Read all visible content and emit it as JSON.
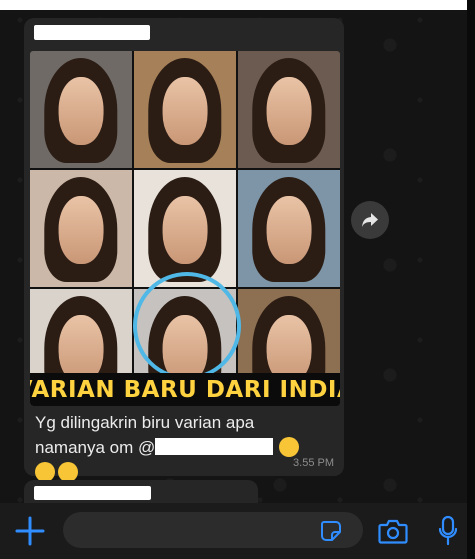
{
  "message": {
    "caption_image_text": "VARIAN BARU DARI INDIA",
    "text_line1": "Yg dilingakrin biru varian apa",
    "text_line2_prefix": "namanya om @",
    "timestamp": "3.55 PM"
  },
  "icons": {
    "forward": "forward-arrow-icon",
    "attach": "plus-icon",
    "sticker": "sticker-icon",
    "camera": "camera-icon",
    "mic": "microphone-icon"
  },
  "colors": {
    "accent": "#2f8dff",
    "highlight_circle": "#4fb8e6",
    "caption_text": "#ffd23f",
    "bubble": "#262626"
  }
}
